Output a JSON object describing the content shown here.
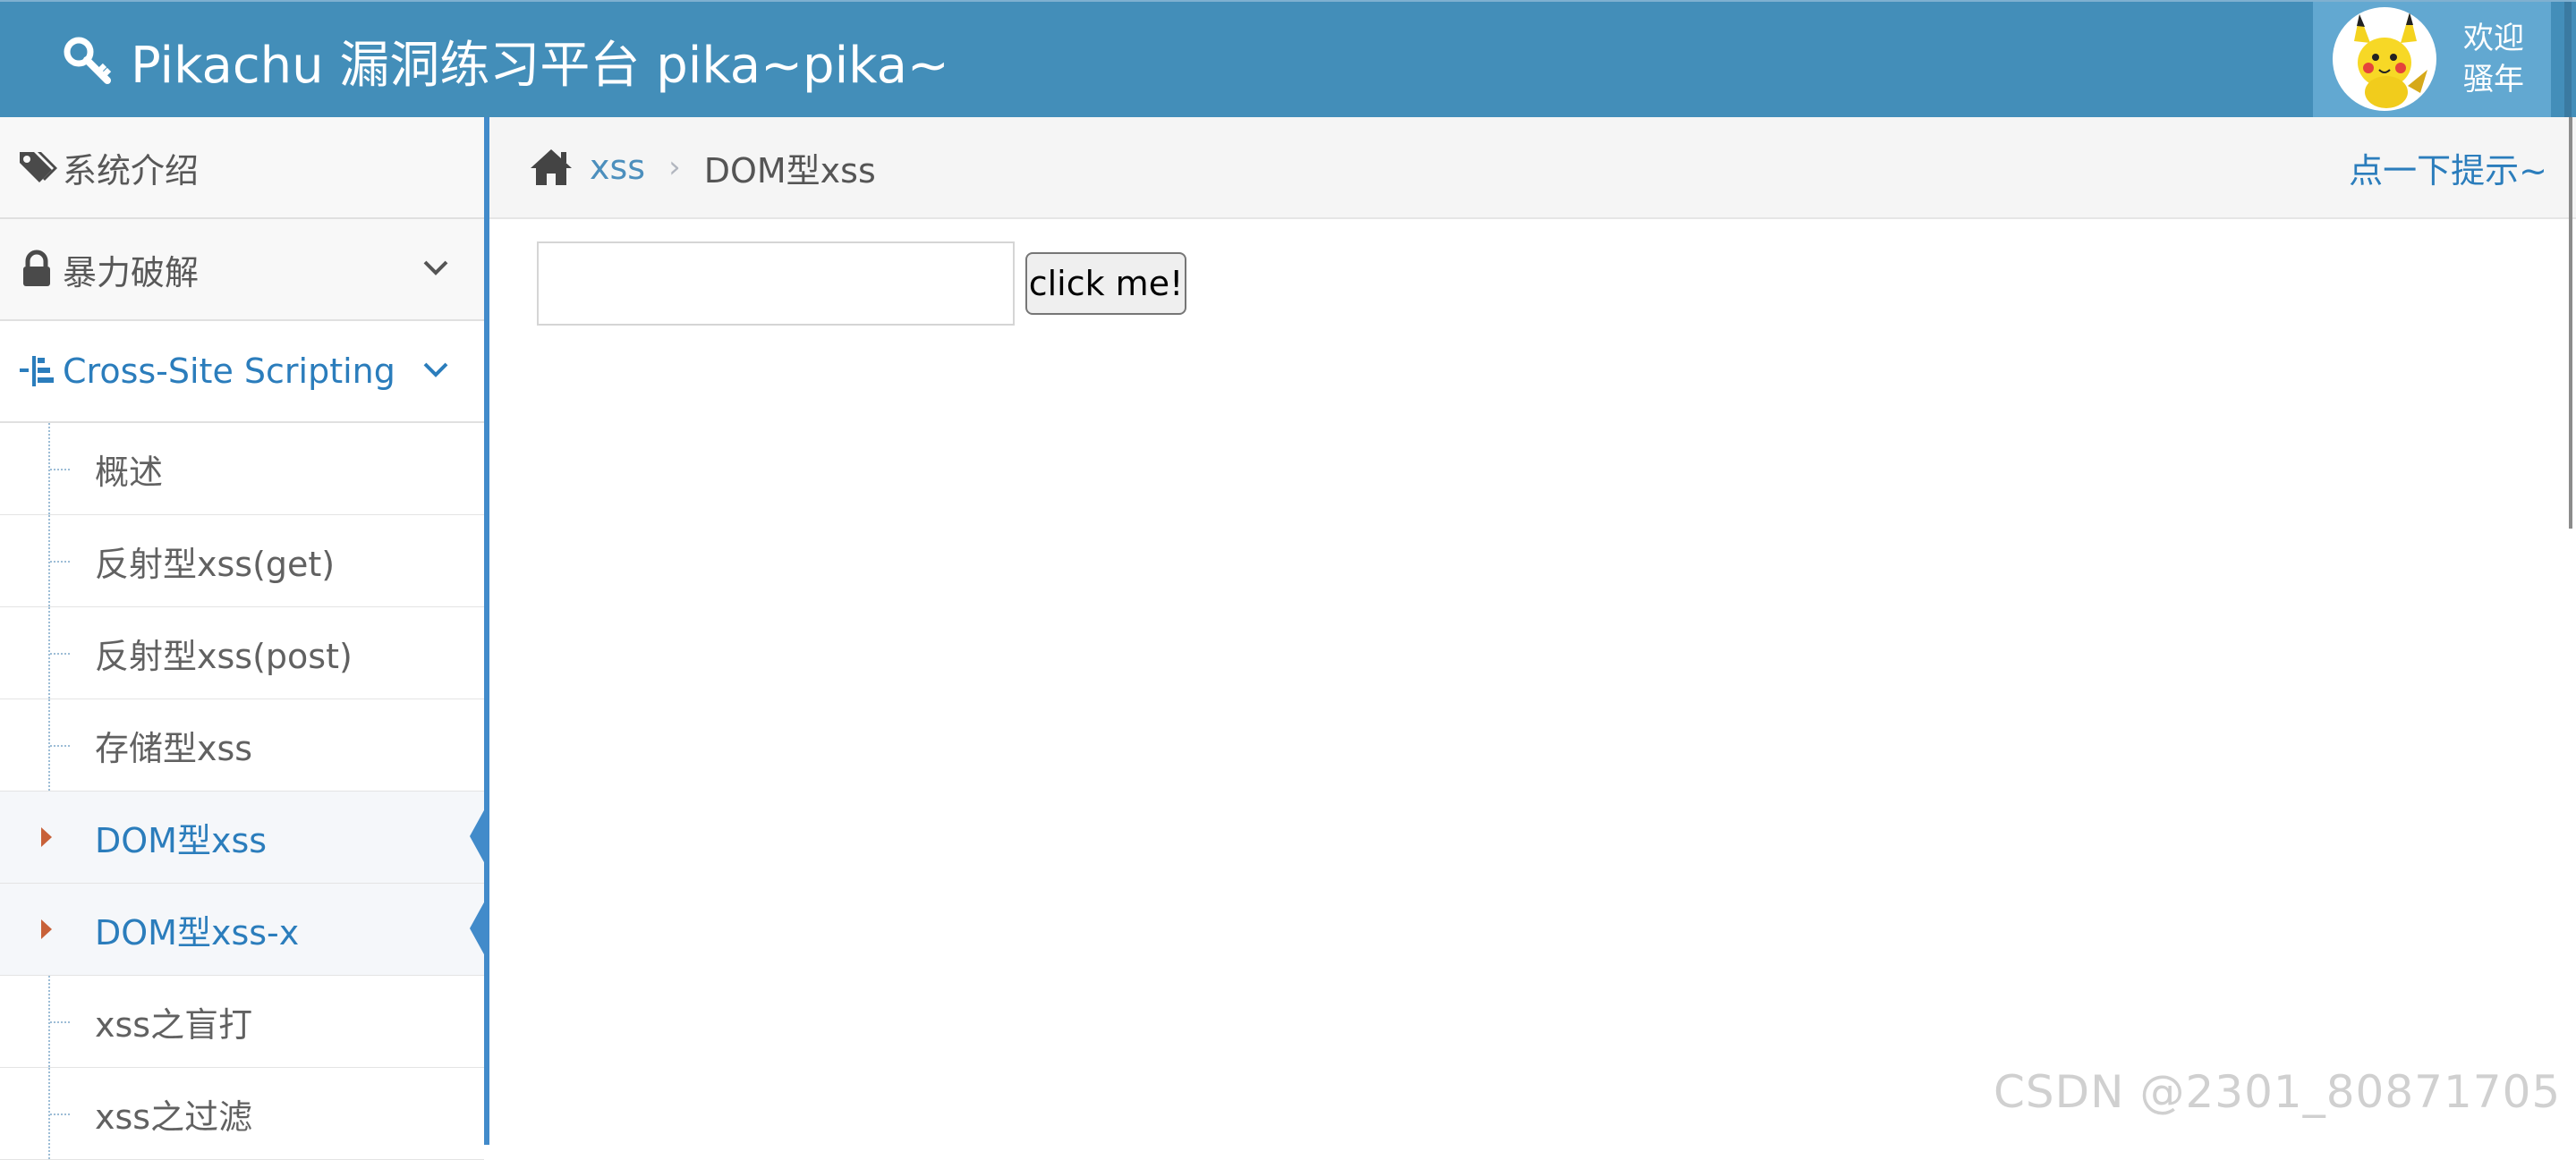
{
  "header": {
    "brand": "Pikachu 漏洞练习平台 pika~pika~",
    "welcome_line1": "欢迎",
    "welcome_line2": "骚年"
  },
  "sidebar": {
    "menus": [
      {
        "label": "系统介绍",
        "icon": "tags-icon"
      },
      {
        "label": "暴力破解",
        "icon": "lock-icon"
      },
      {
        "label": "Cross-Site Scripting",
        "icon": "list-tree-icon"
      }
    ],
    "xss_items": [
      {
        "label": "概述"
      },
      {
        "label": "反射型xss(get)"
      },
      {
        "label": "反射型xss(post)"
      },
      {
        "label": "存储型xss"
      },
      {
        "label": "DOM型xss"
      },
      {
        "label": "DOM型xss-x"
      },
      {
        "label": "xss之盲打"
      },
      {
        "label": "xss之过滤"
      }
    ]
  },
  "breadcrumb": {
    "link": "xss",
    "separator": "›",
    "current": "DOM型xss",
    "hint": "点一下提示~"
  },
  "form": {
    "input_value": "",
    "button_label": "click me!"
  },
  "watermark": "CSDN @2301_80871705",
  "colors": {
    "navbar": "#438eb9",
    "accent": "#2b7dbc",
    "active_caret": "#c86139"
  }
}
